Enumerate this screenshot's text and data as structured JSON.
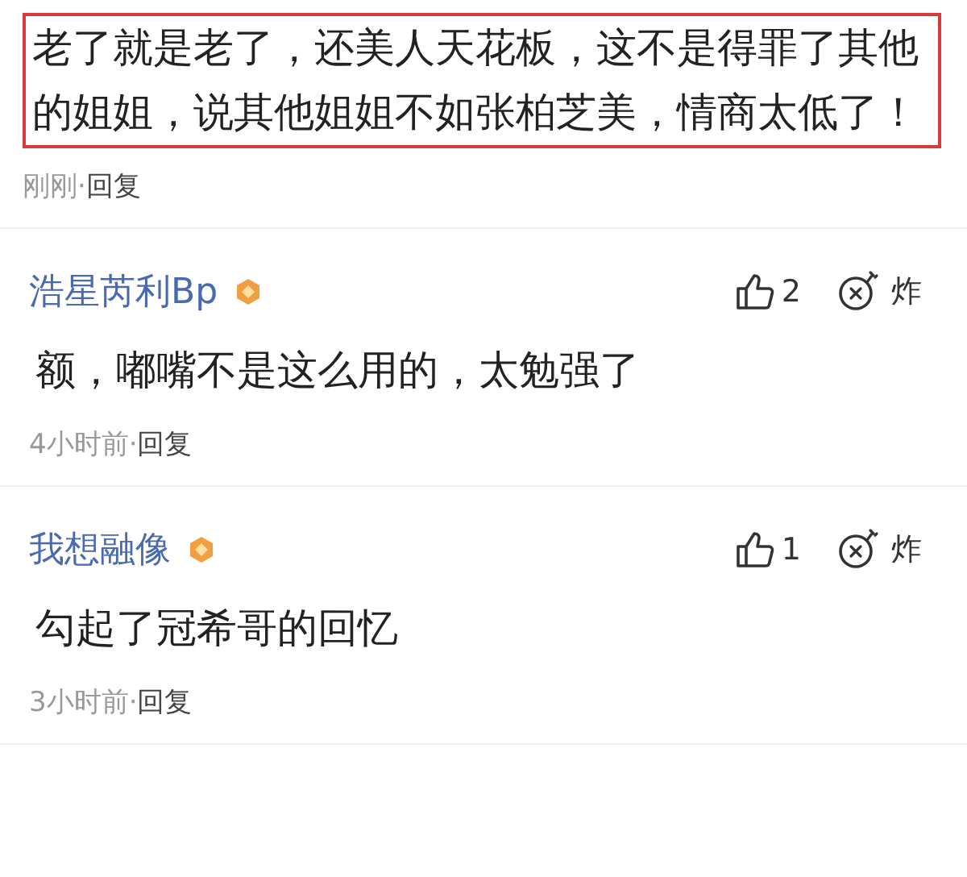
{
  "comments": [
    {
      "highlighted": true,
      "body": "老了就是老了，还美人天花板，这不是得罪了其他的姐姐，说其他姐姐不如张柏芝美，情商太低了！",
      "time": "刚刚",
      "separator": "·",
      "reply": "回复"
    },
    {
      "highlighted": false,
      "user": "浩星芮利Bp",
      "likes": "2",
      "bomb": "炸",
      "body": "额，嘟嘴不是这么用的，太勉强了",
      "time": "4小时前",
      "separator": "·",
      "reply": "回复"
    },
    {
      "highlighted": false,
      "user": "我想融像",
      "likes": "1",
      "bomb": "炸",
      "body": "勾起了冠希哥的回忆",
      "time": "3小时前",
      "separator": "·",
      "reply": "回复"
    }
  ]
}
